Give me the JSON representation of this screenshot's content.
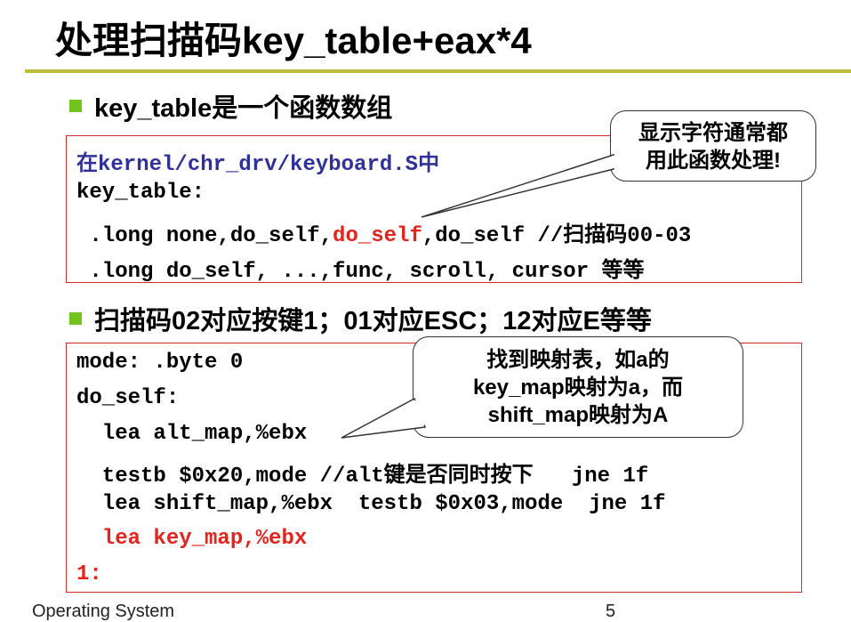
{
  "slide": {
    "title": "处理扫描码key_table+eax*4",
    "bullet1": "key_table是一个函数数组",
    "box1": {
      "line1_prefix": "在",
      "line1_path": "kernel/chr_drv/keyboard.S",
      "line1_suffix": "中",
      "line2": "key_table:",
      "line3_a": " .long none,do_self,",
      "line3_b": "do_self",
      "line3_c": ",do_self //扫描码00-03",
      "line4": " .long do_self, ...,func, scroll, cursor 等等"
    },
    "callout1": {
      "line1": "显示字符通常都",
      "line2": "用此函数处理!"
    },
    "bullet2": "扫描码02对应按键1；01对应ESC；12对应E等等",
    "box2": {
      "line1": "mode: .byte 0",
      "line2": "do_self:",
      "line3": "  lea alt_map,%ebx",
      "line4": "  testb $0x20,mode //alt键是否同时按下   jne 1f",
      "line5": "  lea shift_map,%ebx  testb $0x03,mode  jne 1f",
      "line6": "  lea key_map,%ebx",
      "line7": "1:"
    },
    "callout2": {
      "line1": "找到映射表，如a的",
      "line2": "key_map映射为a，而",
      "line3": "shift_map映射为A"
    },
    "footer": "Operating System",
    "page_number": "5"
  },
  "colors": {
    "title_rule": "#b9bd3a",
    "bullet": "#73c31e",
    "box_border": "#d62a2a",
    "highlight_red": "#e3231c",
    "path_blue": "#30309a"
  }
}
